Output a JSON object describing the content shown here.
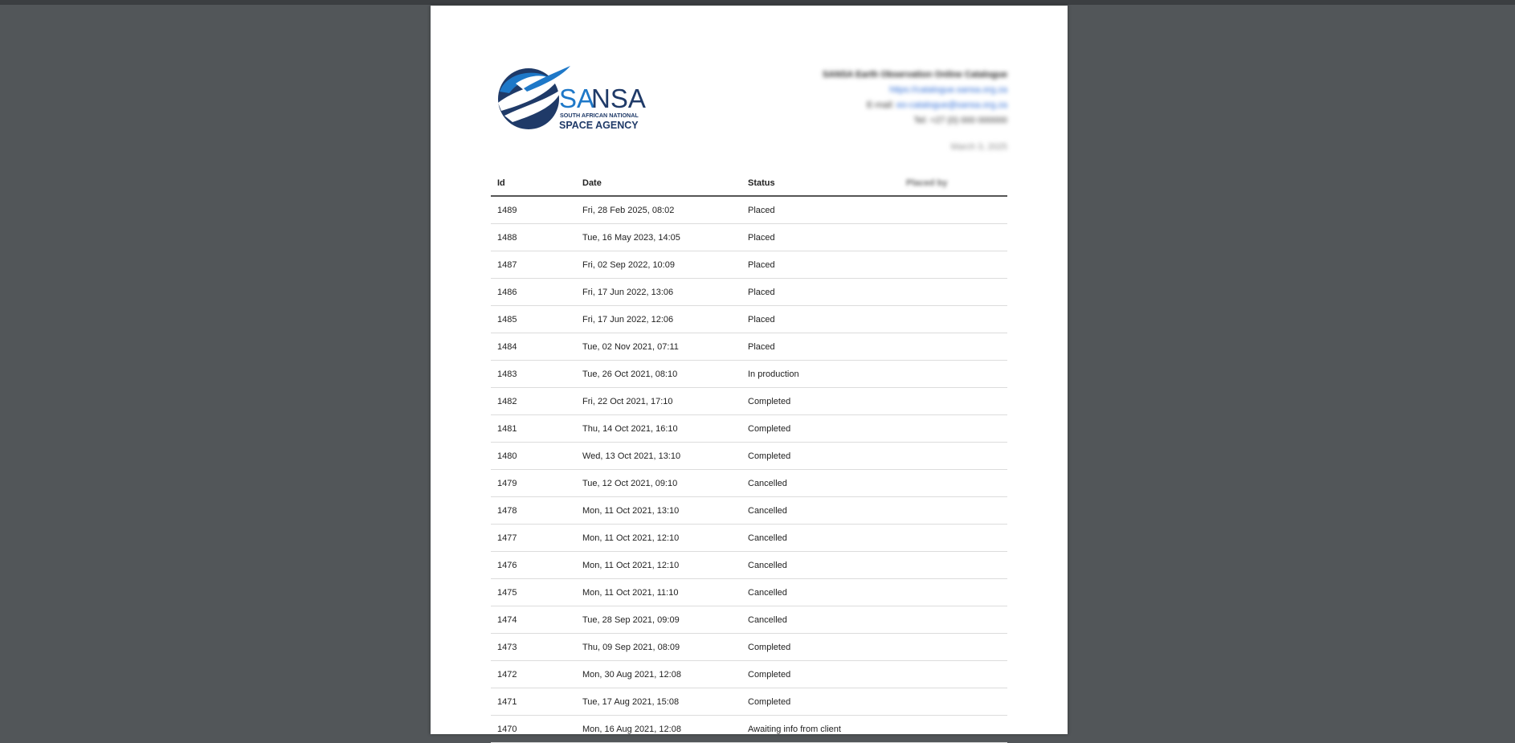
{
  "logo": {
    "text_sa": "SA",
    "text_nsa": "NSA",
    "line1": "SOUTH AFRICAN NATIONAL",
    "line2": "SPACE AGENCY",
    "color_dark": "#1f3a68",
    "color_light": "#1e78c8"
  },
  "contact": {
    "organization": "SANSA Earth Observation Online Catalogue",
    "website": "https://catalogue.sansa.org.za",
    "email_label": "E-mail:",
    "email": "eo-catalogue@sansa.org.za",
    "phone": "Tel: +27 (0) 000 000000",
    "date": "March 3, 2025"
  },
  "table": {
    "headers": {
      "id": "Id",
      "date": "Date",
      "status": "Status",
      "placed_by": "Placed by"
    },
    "rows": [
      {
        "id": "1489",
        "date": "Fri, 28 Feb 2025, 08:02",
        "status": "Placed"
      },
      {
        "id": "1488",
        "date": "Tue, 16 May 2023, 14:05",
        "status": "Placed"
      },
      {
        "id": "1487",
        "date": "Fri, 02 Sep 2022, 10:09",
        "status": "Placed"
      },
      {
        "id": "1486",
        "date": "Fri, 17 Jun 2022, 13:06",
        "status": "Placed"
      },
      {
        "id": "1485",
        "date": "Fri, 17 Jun 2022, 12:06",
        "status": "Placed"
      },
      {
        "id": "1484",
        "date": "Tue, 02 Nov 2021, 07:11",
        "status": "Placed"
      },
      {
        "id": "1483",
        "date": "Tue, 26 Oct 2021, 08:10",
        "status": "In production"
      },
      {
        "id": "1482",
        "date": "Fri, 22 Oct 2021, 17:10",
        "status": "Completed"
      },
      {
        "id": "1481",
        "date": "Thu, 14 Oct 2021, 16:10",
        "status": "Completed"
      },
      {
        "id": "1480",
        "date": "Wed, 13 Oct 2021, 13:10",
        "status": "Completed"
      },
      {
        "id": "1479",
        "date": "Tue, 12 Oct 2021, 09:10",
        "status": "Cancelled"
      },
      {
        "id": "1478",
        "date": "Mon, 11 Oct 2021, 13:10",
        "status": "Cancelled"
      },
      {
        "id": "1477",
        "date": "Mon, 11 Oct 2021, 12:10",
        "status": "Cancelled"
      },
      {
        "id": "1476",
        "date": "Mon, 11 Oct 2021, 12:10",
        "status": "Cancelled"
      },
      {
        "id": "1475",
        "date": "Mon, 11 Oct 2021, 11:10",
        "status": "Cancelled"
      },
      {
        "id": "1474",
        "date": "Tue, 28 Sep 2021, 09:09",
        "status": "Cancelled"
      },
      {
        "id": "1473",
        "date": "Thu, 09 Sep 2021, 08:09",
        "status": "Completed"
      },
      {
        "id": "1472",
        "date": "Mon, 30 Aug 2021, 12:08",
        "status": "Completed"
      },
      {
        "id": "1471",
        "date": "Tue, 17 Aug 2021, 15:08",
        "status": "Completed"
      },
      {
        "id": "1470",
        "date": "Mon, 16 Aug 2021, 12:08",
        "status": "Awaiting info from client"
      }
    ]
  }
}
